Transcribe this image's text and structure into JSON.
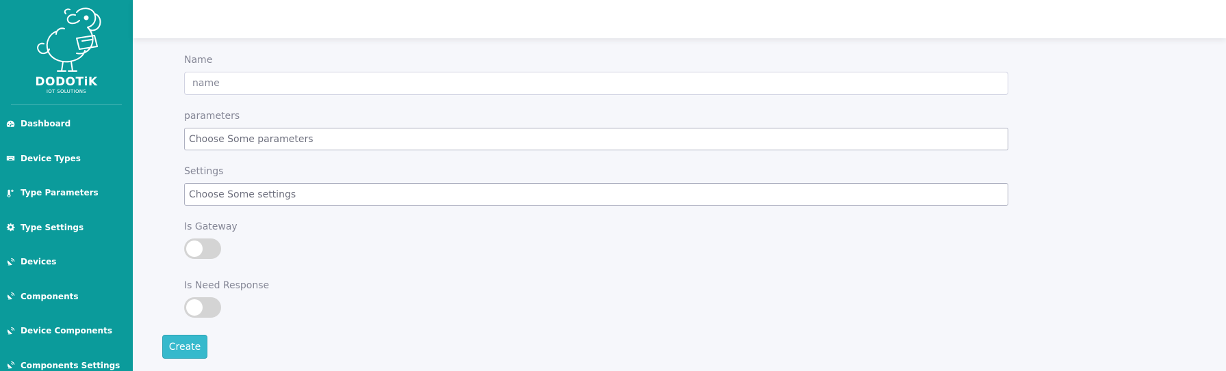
{
  "brand": {
    "title": "DODOTiK",
    "subtitle": "IOT SOLUTIONS"
  },
  "sidebar": {
    "items": [
      {
        "label": "Dashboard",
        "icon": "dashboard-icon"
      },
      {
        "label": "Device Types",
        "icon": "keyboard-icon"
      },
      {
        "label": "Type Parameters",
        "icon": "thermometer-icon"
      },
      {
        "label": "Type Settings",
        "icon": "gear-icon"
      },
      {
        "label": "Devices",
        "icon": "satellite-dish-icon"
      },
      {
        "label": "Components",
        "icon": "satellite-dish-icon"
      },
      {
        "label": "Device Components",
        "icon": "satellite-dish-icon"
      },
      {
        "label": "Components Settings",
        "icon": "satellite-dish-icon"
      }
    ]
  },
  "form": {
    "name_label": "Name",
    "name_placeholder": "name",
    "name_value": "",
    "parameters_label": "parameters",
    "parameters_placeholder": "Choose Some parameters",
    "settings_label": "Settings",
    "settings_placeholder": "Choose Some settings",
    "gateway_label": "Is Gateway",
    "gateway_on": false,
    "response_label": "Is Need Response",
    "response_on": false,
    "create_label": "Create"
  },
  "colors": {
    "sidebar": "#0b9b9b",
    "button": "#36b9cc",
    "toggle_off": "#d4d4d4"
  }
}
